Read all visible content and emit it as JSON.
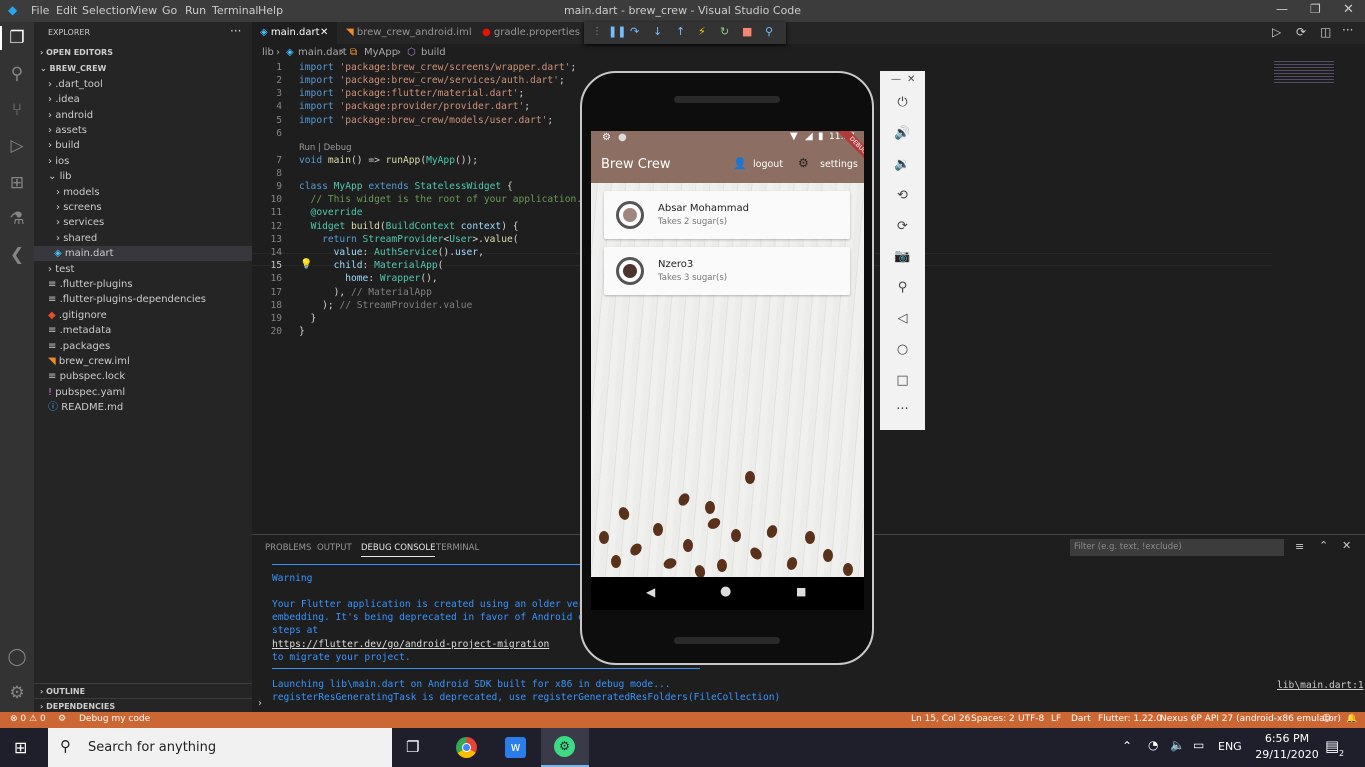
{
  "window": {
    "title": "main.dart - brew_crew - Visual Studio Code"
  },
  "menu": [
    "File",
    "Edit",
    "Selection",
    "View",
    "Go",
    "Run",
    "Terminal",
    "Help"
  ],
  "explorer": {
    "header": "EXPLORER",
    "open_editors": "OPEN EDITORS",
    "project": "BREW_CREW",
    "tree": [
      ".dart_tool",
      ".idea",
      "android",
      "assets",
      "build",
      "ios",
      "lib",
      "models",
      "screens",
      "services",
      "shared",
      "main.dart",
      "test",
      ".flutter-plugins",
      ".flutter-plugins-dependencies",
      ".gitignore",
      ".metadata",
      ".packages",
      "brew_crew.iml",
      "pubspec.lock",
      "pubspec.yaml",
      "README.md"
    ],
    "outline": "OUTLINE",
    "dependencies": "DEPENDENCIES"
  },
  "tabs": [
    "main.dart",
    "brew_crew_android.iml",
    "gradle.properties"
  ],
  "breadcrumb": {
    "a": "lib",
    "b": "main.dart",
    "c": "MyApp",
    "d": "build"
  },
  "code": {
    "line_numbers": [
      "1",
      "2",
      "3",
      "4",
      "5",
      "6",
      "7",
      "8",
      "9",
      "10",
      "11",
      "12",
      "13",
      "14",
      "15",
      "16",
      "17",
      "18",
      "19",
      "20"
    ],
    "codelens": "Run | Debug",
    "l1": [
      "import ",
      "'package:brew_crew/screens/wrapper.dart'",
      ";"
    ],
    "l2": [
      "import ",
      "'package:brew_crew/services/auth.dart'",
      ";"
    ],
    "l3": [
      "import ",
      "'package:flutter/material.dart'",
      ";"
    ],
    "l4": [
      "import ",
      "'package:provider/provider.dart'",
      ";"
    ],
    "l5": [
      "import ",
      "'package:brew_crew/models/user.dart'",
      ";"
    ],
    "l7": [
      "void ",
      "main",
      "() => ",
      "runApp",
      "(",
      "MyApp",
      "());"
    ],
    "l9": [
      "class ",
      "MyApp ",
      "extends ",
      "StatelessWidget",
      " {"
    ],
    "l10": "  // This widget is the root of your application.",
    "l11": "  @override",
    "l12": [
      "  ",
      "Widget ",
      "build",
      "(",
      "BuildContext ",
      "context",
      ") {"
    ],
    "l13": [
      "    ",
      "return ",
      "StreamProvider",
      "<",
      "User",
      ">.",
      "value",
      "("
    ],
    "l14": [
      "      ",
      "value",
      ": ",
      "AuthService",
      "().",
      "user",
      ","
    ],
    "l15": [
      "      ",
      "child",
      ": ",
      "MaterialApp",
      "("
    ],
    "l16": [
      "        ",
      "home",
      ": ",
      "Wrapper",
      "(),"
    ],
    "l17": [
      "      ",
      "), ",
      "// MaterialApp"
    ],
    "l18": [
      "    ",
      "); ",
      "// StreamProvider.value"
    ],
    "l19": "  }",
    "l20": "}"
  },
  "panel": {
    "tabs": [
      "PROBLEMS",
      "OUTPUT",
      "DEBUG CONSOLE",
      "TERMINAL"
    ],
    "filter_placeholder": "Filter (e.g. text, !exclude)",
    "lines": [
      "Warning",
      "Your Flutter application is created using an older versi",
      "embedding. It's being deprecated in favor of Android emb",
      "steps at",
      "https://flutter.dev/go/android-project-migration",
      "to migrate your project.",
      "Launching lib\\main.dart on Android SDK built for x86 in debug mode...",
      "registerResGeneratingTask is deprecated, use registerGeneratedResFolders(FileCollection)"
    ],
    "source_link": "lib\\main.dart:1"
  },
  "status": {
    "errors": "0",
    "warnings": "0",
    "debug": "Debug my code",
    "position": "Ln 15, Col 26",
    "spaces": "Spaces: 2",
    "encoding": "UTF-8",
    "eol": "LF",
    "lang": "Dart",
    "flutter": "Flutter: 1.22.0",
    "device": "Nexus 6P API 27 (android-x86 emulator)"
  },
  "phone": {
    "time": "11:57",
    "app_title": "Brew Crew",
    "logout": "logout",
    "settings": "settings",
    "debug_banner": "DEBUG",
    "brews": [
      {
        "name": "Absar Mohammad",
        "sugar": "Takes 2 sugar(s)"
      },
      {
        "name": "Nzero3",
        "sugar": "Takes 3 sugar(s)"
      }
    ]
  },
  "taskbar": {
    "search": "Search for anything",
    "lang": "ENG",
    "time": "6:56 PM",
    "date": "29/11/2020",
    "notifications": "2"
  },
  "colors": {
    "statusbar": "#cc6633",
    "appbar": "#8d6e63",
    "accent": "#007acc"
  }
}
